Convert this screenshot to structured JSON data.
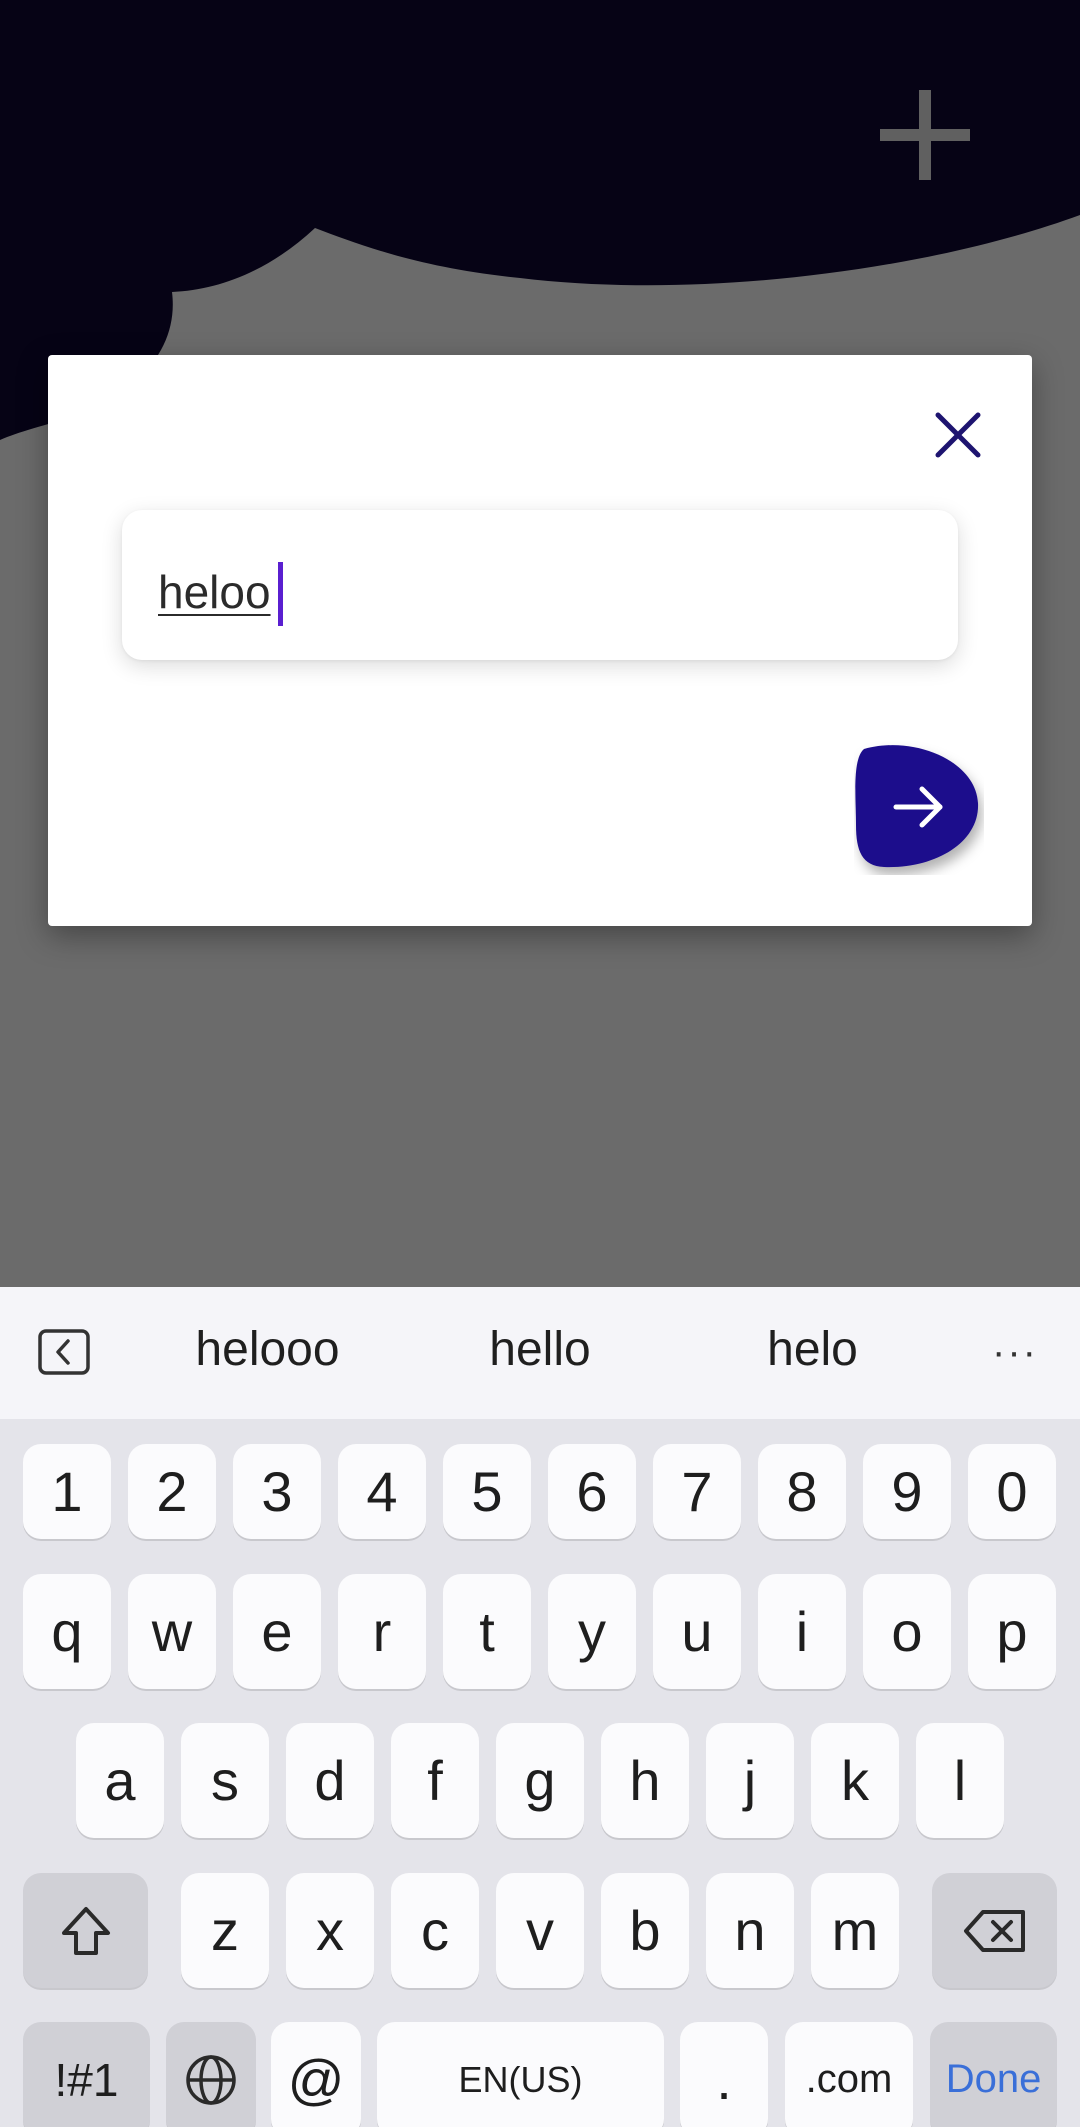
{
  "background_app": {
    "add_icon": "plus-icon",
    "colors": {
      "header": "#0f0833",
      "accent": "#1e0f8c"
    }
  },
  "dialog": {
    "close_icon": "close-icon",
    "input_value": "heloo",
    "submit_icon": "arrow-right-icon"
  },
  "keyboard": {
    "suggestions": [
      "helooo",
      "hello",
      "helo"
    ],
    "suggestion_back_icon": "chevron-left-icon",
    "more_icon": "ellipsis-icon",
    "more_label": "···",
    "rows": {
      "numbers": [
        "1",
        "2",
        "3",
        "4",
        "5",
        "6",
        "7",
        "8",
        "9",
        "0"
      ],
      "row1": [
        "q",
        "w",
        "e",
        "r",
        "t",
        "y",
        "u",
        "i",
        "o",
        "p"
      ],
      "row2": [
        "a",
        "s",
        "d",
        "f",
        "g",
        "h",
        "j",
        "k",
        "l"
      ],
      "row3": [
        "z",
        "x",
        "c",
        "v",
        "b",
        "n",
        "m"
      ]
    },
    "shift_icon": "shift-icon",
    "backspace_icon": "backspace-icon",
    "symbols_label": "!#1",
    "globe_icon": "globe-icon",
    "at_label": "@",
    "space_label": "EN(US)",
    "period_label": ".",
    "dotcom_label": ".com",
    "done_label": "Done"
  }
}
